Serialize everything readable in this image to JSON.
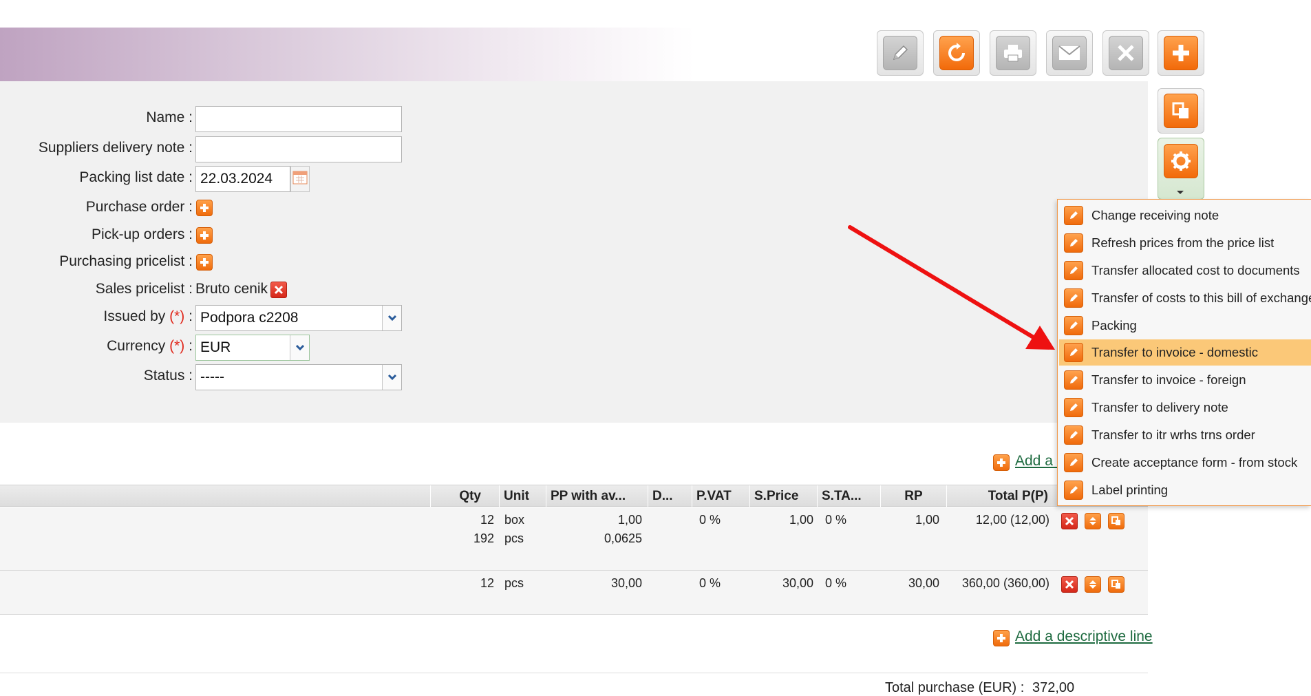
{
  "toolbar": {
    "buttons": [
      {
        "icon": "pencil-icon",
        "style": "grey"
      },
      {
        "icon": "refresh-icon",
        "style": "orange"
      },
      {
        "icon": "printer-icon",
        "style": "grey"
      },
      {
        "icon": "mail-icon",
        "style": "grey"
      },
      {
        "icon": "close-icon",
        "style": "grey"
      },
      {
        "icon": "plus-icon",
        "style": "orange"
      }
    ],
    "copy_icon": "copy-icon",
    "settings_icon": "gear-icon"
  },
  "form": {
    "name_label": "Name :",
    "name_value": "",
    "suppliers_note_label": "Suppliers delivery note :",
    "suppliers_note_value": "",
    "packing_date_label": "Packing list date :",
    "packing_date_value": "22.03.2024",
    "purchase_order_label": "Purchase order :",
    "pickup_orders_label": "Pick-up orders :",
    "purchasing_pricelist_label": "Purchasing pricelist :",
    "sales_pricelist_label": "Sales pricelist :",
    "sales_pricelist_value": "Bruto cenik",
    "issued_by_label": "Issued by",
    "issued_by_value": "Podpora c2208",
    "currency_label": "Currency",
    "currency_value": "EUR",
    "status_label": "Status :",
    "status_value": "-----",
    "required_mark": "(*)",
    "colon": ":"
  },
  "links": {
    "add_top": "Add a d",
    "add_descriptive": "Add a descriptive line"
  },
  "table": {
    "columns": [
      "Qty",
      "Unit",
      "PP with av...",
      "D...",
      "P.VAT",
      "S.Price",
      "S.TA...",
      "RP",
      "Total P(P)"
    ],
    "rows": [
      {
        "qty": "12",
        "unit": "box",
        "pp": "1,00",
        "pvat": "0 %",
        "sprice": "1,00",
        "stax": "0 %",
        "rp": "1,00",
        "total": "12,00 (12,00)",
        "qty2": "192",
        "unit2": "pcs",
        "pp2": "0,0625"
      },
      {
        "qty": "12",
        "unit": "pcs",
        "pp": "30,00",
        "pvat": "0 %",
        "sprice": "30,00",
        "stax": "0 %",
        "rp": "30,00",
        "total": "360,00 (360,00)"
      }
    ]
  },
  "totals": {
    "label": "Total purchase (EUR) :",
    "value": "372,00"
  },
  "menu": {
    "items": [
      "Change receiving note",
      "Refresh prices from the price list",
      "Transfer allocated cost to documents",
      "Transfer of costs to this bill of exchange",
      "Packing",
      "Transfer to invoice - domestic",
      "Transfer to invoice - foreign",
      "Transfer to delivery note",
      "Transfer to itr wrhs trns order",
      "Create acceptance form - from stock",
      "Label printing"
    ],
    "highlighted_index": 5
  },
  "colors": {
    "accent_orange": "#f26a0a",
    "highlight": "#fbc878",
    "arrow_red": "#ee1111",
    "link_green": "#1d6a3f"
  }
}
